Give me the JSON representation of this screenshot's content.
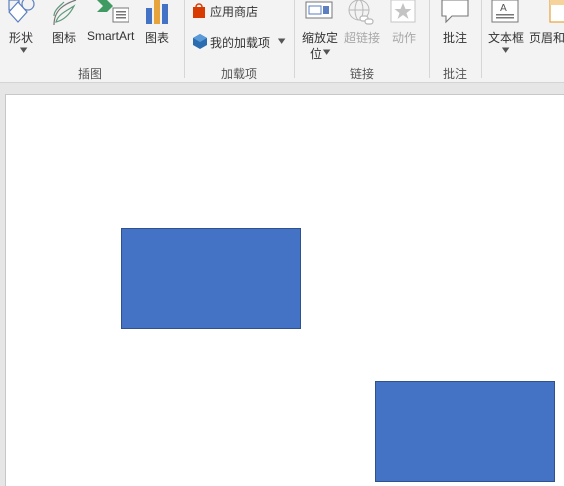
{
  "ribbon": {
    "groups": {
      "illustrations": {
        "label": "插图",
        "buttons": {
          "shapes": {
            "label": "形状",
            "icon": "shapes-icon"
          },
          "icons": {
            "label": "图标",
            "icon": "icons-icon"
          },
          "smartart": {
            "label": "SmartArt",
            "icon": "smartart-icon"
          },
          "chart": {
            "label": "图表",
            "icon": "chart-icon"
          }
        }
      },
      "addins": {
        "label": "加载项",
        "store_label": "应用商店",
        "my_addins_label": "我的加载项"
      },
      "links": {
        "label": "链接",
        "buttons": {
          "zoom": {
            "label_line1": "缩放定",
            "label_line2": "位"
          },
          "hyperlink": {
            "label": "超链接"
          },
          "action": {
            "label": "动作"
          }
        }
      },
      "comments": {
        "label": "批注",
        "buttons": {
          "comment": {
            "label": "批注"
          }
        }
      },
      "text": {
        "buttons": {
          "textbox": {
            "label": "文本框"
          },
          "header_footer": {
            "label": "页眉和"
          }
        }
      }
    }
  },
  "slide": {
    "shapes": [
      {
        "type": "rectangle",
        "fill": "#4472c4",
        "stroke": "#2f528f"
      },
      {
        "type": "rectangle",
        "fill": "#4472c4",
        "stroke": "#2f528f"
      }
    ]
  },
  "colors": {
    "ribbon_bg": "#f3f3f3",
    "canvas_bg": "#e6e6e6",
    "shape_fill": "#4472c4",
    "shape_stroke": "#2f528f",
    "accent_red": "#d83b01"
  }
}
